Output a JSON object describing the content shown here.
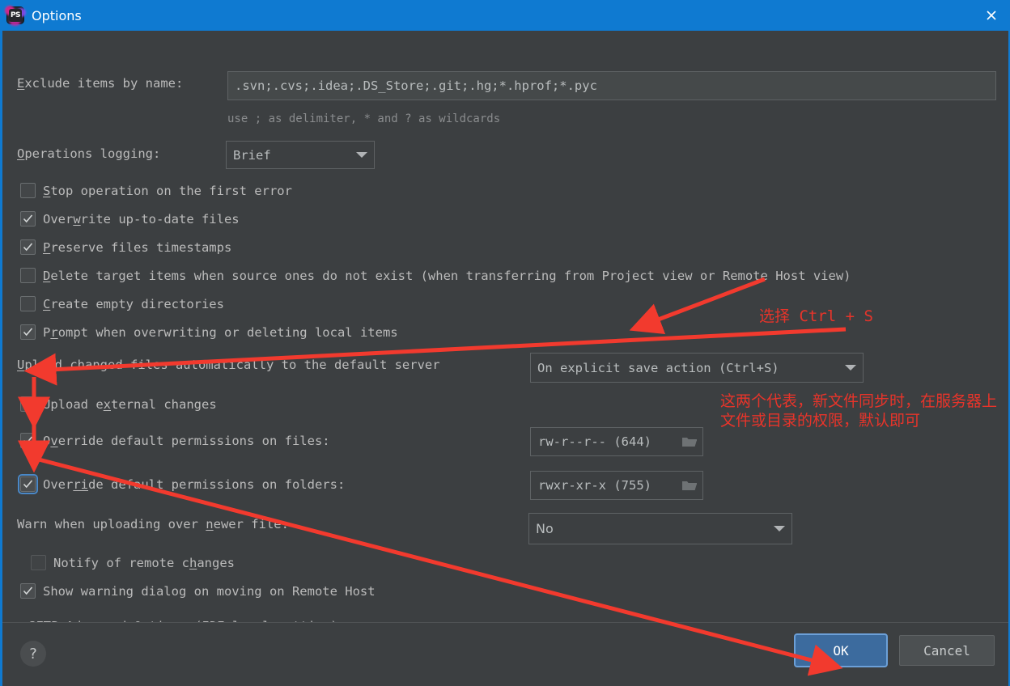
{
  "window": {
    "title": "Options",
    "app_icon": "phpstorm-icon",
    "icon_text": "PS",
    "close_icon": "close-icon"
  },
  "form": {
    "exclude": {
      "label": "Exclude items by name:",
      "mnemonic": "E",
      "value": ".svn;.cvs;.idea;.DS_Store;.git;.hg;*.hprof;*.pyc",
      "hint": "use ; as delimiter, * and ? as wildcards"
    },
    "logging": {
      "label": "Operations logging:",
      "mnemonic": "O",
      "value": "Brief"
    },
    "checkboxes": [
      {
        "label": "Stop operation on the first error",
        "mnemonic": "S",
        "checked": false,
        "disabled": false,
        "focused": false
      },
      {
        "label": "Overwrite up-to-date files",
        "mnemonic": "w",
        "checked": true,
        "disabled": false,
        "focused": false
      },
      {
        "label": "Preserve files timestamps",
        "mnemonic": "P",
        "checked": true,
        "disabled": false,
        "focused": false
      },
      {
        "label": "Delete target items when source ones do not exist (when transferring from Project view or Remote Host view)",
        "mnemonic": "D",
        "checked": false,
        "disabled": false,
        "focused": false
      },
      {
        "label": "Create empty directories",
        "mnemonic": "C",
        "checked": false,
        "disabled": false,
        "focused": false
      },
      {
        "label": "Prompt when overwriting or deleting local items",
        "mnemonic": "r",
        "checked": true,
        "disabled": false,
        "focused": false
      }
    ],
    "upload_auto": {
      "label": "Upload changed files automatically to the default server",
      "mnemonic": "U",
      "value": "On explicit save action (Ctrl+S)"
    },
    "upload_external": {
      "label": "Upload external changes",
      "mnemonic": "x",
      "checked": true
    },
    "perm_files": {
      "label": "Override default permissions on files:",
      "mnemonic": "v",
      "checked": true,
      "value": "rw-r--r-- (644)",
      "browse_icon": "folder-icon"
    },
    "perm_folders": {
      "label": "Override default permissions on folders:",
      "mnemonic": "ri",
      "checked": true,
      "focused": true,
      "value": "rwxr-xr-x (755)",
      "browse_icon": "folder-icon"
    },
    "warn_newer": {
      "label": "Warn when uploading over newer file:",
      "mnemonic": "n",
      "value": "No"
    },
    "notify_remote": {
      "label": "Notify of remote changes",
      "mnemonic": "h",
      "checked": false,
      "disabled": true
    },
    "show_warning": {
      "label": "Show warning dialog on moving on Remote Host",
      "checked": true
    },
    "sftp_advanced": {
      "label": "SFTP Advanced Options (IDE level setting)",
      "twisty": "chevron-right-icon",
      "expanded": false
    }
  },
  "footer": {
    "help_icon": "question-mark-icon",
    "ok_label": "OK",
    "cancel_label": "Cancel"
  },
  "annotations": [
    {
      "id": "ctrl-s",
      "text": "选择 Ctrl + S"
    },
    {
      "id": "permissions",
      "text": "这两个代表，新文件同步时，在服务器上文件或目录的权限，默认即可"
    }
  ],
  "colors": {
    "titlebar": "#0f7ad1",
    "dialog_bg": "#3c3f41",
    "text": "#bbbbbb",
    "accent_blue": "#3c6b9e",
    "focus_ring": "#6ca0d8",
    "annotation_red": "#e8342a"
  }
}
